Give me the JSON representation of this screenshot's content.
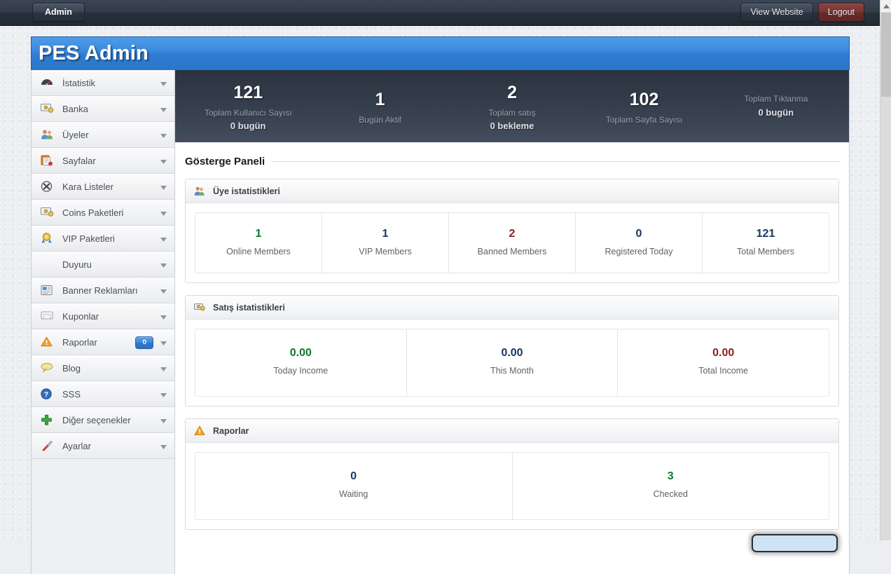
{
  "topbar": {
    "admin_button": "Admin",
    "view_website_button": "View Website",
    "logout_button": "Logout"
  },
  "brand": {
    "title": "PES Admin"
  },
  "sidebar": {
    "items": [
      {
        "label": "İstatistik",
        "icon": "speedometer-icon",
        "glyph": "🌡",
        "caret": "▼",
        "badge": null
      },
      {
        "label": "Banka",
        "icon": "money-icon",
        "glyph": "💵",
        "caret": "▼",
        "badge": null
      },
      {
        "label": "Üyeler",
        "icon": "users-icon",
        "glyph": "👥",
        "caret": "▼",
        "badge": null
      },
      {
        "label": "Sayfalar",
        "icon": "pages-icon",
        "glyph": "📑",
        "caret": "▼",
        "badge": null
      },
      {
        "label": "Kara Listeler",
        "icon": "blacklist-icon",
        "glyph": "✖",
        "caret": "▼",
        "badge": null
      },
      {
        "label": "Coins Paketleri",
        "icon": "money-icon",
        "glyph": "💵",
        "caret": "▼",
        "badge": null
      },
      {
        "label": "VIP Paketleri",
        "icon": "medal-icon",
        "glyph": "🏅",
        "caret": "▼",
        "badge": null
      },
      {
        "label": "Duyuru",
        "icon": "none",
        "glyph": "",
        "caret": "▼",
        "badge": null
      },
      {
        "label": "Banner Reklamları",
        "icon": "banner-icon",
        "glyph": "🗞",
        "caret": "▼",
        "badge": null
      },
      {
        "label": "Kuponlar",
        "icon": "coupon-icon",
        "glyph": "📄",
        "caret": "▼",
        "badge": null
      },
      {
        "label": "Raporlar",
        "icon": "warning-icon",
        "glyph": "⚠",
        "caret": "▼",
        "badge": "0"
      },
      {
        "label": "Blog",
        "icon": "comment-icon",
        "glyph": "💬",
        "caret": "▼",
        "badge": null
      },
      {
        "label": "SSS",
        "icon": "help-icon",
        "glyph": "?",
        "caret": "▼",
        "badge": null
      },
      {
        "label": "Diğer seçenekler",
        "icon": "plus-icon",
        "glyph": "➕",
        "caret": "▼",
        "badge": null
      },
      {
        "label": "Ayarlar",
        "icon": "wrench-icon",
        "glyph": "✒",
        "caret": "▼",
        "badge": null
      }
    ]
  },
  "statbar": {
    "cells": [
      {
        "value": "121",
        "label": "Toplam Kullanıcı Sayısı",
        "sub": "0 bugün"
      },
      {
        "value": "1",
        "label": "Bugün Aktif",
        "sub": ""
      },
      {
        "value": "2",
        "label": "Toplam satış",
        "sub": "0 bekleme"
      },
      {
        "value": "102",
        "label": "Toplam Sayfa Sayısı",
        "sub": ""
      },
      {
        "value": "",
        "label": "Toplam Tıklanma",
        "sub": "0 bugün"
      }
    ]
  },
  "page": {
    "heading": "Gösterge Paneli"
  },
  "panels": {
    "members": {
      "title": "Üye istatistikleri",
      "icon": "users-icon",
      "glyph": "👥",
      "stats": [
        {
          "value": "1",
          "caption": "Online Members",
          "color": "#0a7a2f"
        },
        {
          "value": "1",
          "caption": "VIP Members",
          "color": "#17365d"
        },
        {
          "value": "2",
          "caption": "Banned Members",
          "color": "#8f1c1c"
        },
        {
          "value": "0",
          "caption": "Registered Today",
          "color": "#17365d"
        },
        {
          "value": "121",
          "caption": "Total Members",
          "color": "#17365d"
        }
      ]
    },
    "sales": {
      "title": "Satış istatistikleri",
      "icon": "money-icon",
      "glyph": "💵",
      "stats": [
        {
          "value": "0.00",
          "caption": "Today Income",
          "color": "#0a7a2f"
        },
        {
          "value": "0.00",
          "caption": "This Month",
          "color": "#17365d"
        },
        {
          "value": "0.00",
          "caption": "Total Income",
          "color": "#8f1c1c"
        }
      ]
    },
    "reports": {
      "title": "Raporlar",
      "icon": "warning-icon",
      "glyph": "⚠",
      "stats": [
        {
          "value": "0",
          "caption": "Waiting",
          "color": "#17365d"
        },
        {
          "value": "3",
          "caption": "Checked",
          "color": "#0a7a2f"
        }
      ]
    }
  },
  "colors": {
    "brand_blue": "#2f7ed3",
    "topbar_dark": "#2b3340",
    "logout_red": "#7a3534",
    "badge_blue": "#3c86d6"
  }
}
